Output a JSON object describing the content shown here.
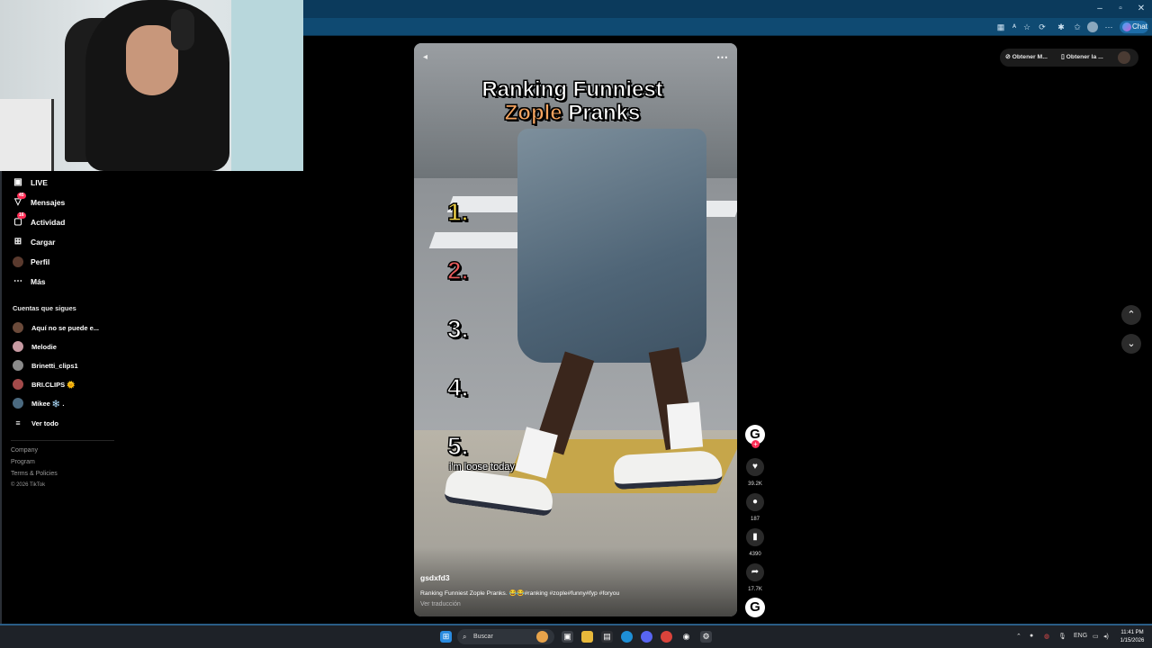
{
  "browser": {
    "chat_label": "Chat",
    "window_controls": [
      "–",
      "▫",
      "✕"
    ]
  },
  "sidebar": {
    "items": [
      {
        "label": "LIVE",
        "icon": "live-icon"
      },
      {
        "label": "Mensajes",
        "icon": "inbox-icon",
        "badge": "45"
      },
      {
        "label": "Actividad",
        "icon": "activity-icon",
        "badge": "16"
      },
      {
        "label": "Cargar",
        "icon": "upload-icon"
      },
      {
        "label": "Perfil",
        "icon": "profile-avatar"
      },
      {
        "label": "Más",
        "icon": "more-icon"
      }
    ],
    "following_header": "Cuentas que sigues",
    "following": [
      {
        "name": "Aquí no se puede e...",
        "color": "#6b4a3a"
      },
      {
        "name": "Melodie",
        "color": "#c79aa2"
      },
      {
        "name": "Brinetti_clips1",
        "color": "#8a8a8a"
      },
      {
        "name": "BRI.CLIPS 🌞",
        "color": "#a34a4a"
      },
      {
        "name": "Mikee ❄️ .",
        "color": "#4b6a80"
      }
    ],
    "see_all": "Ver todo",
    "footer": {
      "company": "Company",
      "program": "Program",
      "terms": "Terms & Policies",
      "copyright": "© 2026 TikTok"
    }
  },
  "video": {
    "title_line1": "Ranking Funniest",
    "title_highlight": "Zople",
    "title_line2_rest": " Pranks",
    "ranks": [
      {
        "label": "1.",
        "color": "#f7d84a"
      },
      {
        "label": "2.",
        "color": "#e85b5b"
      },
      {
        "label": "3.",
        "color": "#ffffff"
      },
      {
        "label": "4.",
        "color": "#ffffff"
      },
      {
        "label": "5.",
        "color": "#ffffff"
      }
    ],
    "inline_caption": "i'm loose today",
    "author": "gsdxfd3",
    "description": "Ranking Funniest Zople Pranks. 😂😂#ranking #zople#funny#fyp #foryou",
    "translate": "Ver traducción"
  },
  "actions": {
    "avatar_letter": "G",
    "likes": "39.2K",
    "comments": "187",
    "saves": "4390",
    "shares": "17.7K",
    "sound_letter": "G"
  },
  "top_right": {
    "get_app": "Obtener M...",
    "get_desktop": "Obtener la ..."
  },
  "taskbar": {
    "search_placeholder": "Buscar",
    "lang": "ENG",
    "time": "11:41 PM",
    "date": "1/15/2026"
  }
}
